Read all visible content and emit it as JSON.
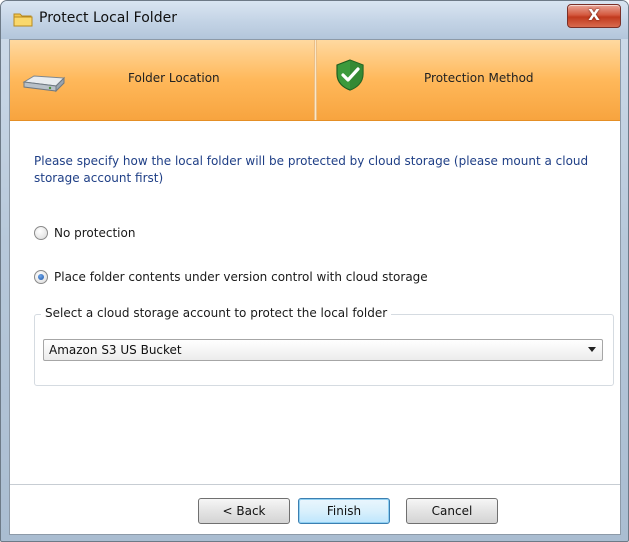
{
  "window": {
    "title": "Protect Local Folder",
    "close_label": "X"
  },
  "steps": [
    {
      "label": "Folder Location",
      "icon": "drive-icon"
    },
    {
      "label": "Protection Method",
      "icon": "shield-check-icon"
    }
  ],
  "instruction": "Please specify how the local folder will be protected by cloud storage (please mount a cloud storage account first)",
  "options": [
    {
      "label": "No protection",
      "checked": false
    },
    {
      "label": "Place folder contents under version control with cloud storage",
      "checked": true
    }
  ],
  "account_group": {
    "legend": "Select a cloud storage account to protect the local folder",
    "selected": "Amazon S3 US Bucket"
  },
  "buttons": {
    "back": "< Back",
    "finish": "Finish",
    "cancel": "Cancel"
  },
  "colors": {
    "header_orange": "#ffb85a",
    "instruction_blue": "#1f3f86",
    "close_red": "#c13a1e"
  }
}
